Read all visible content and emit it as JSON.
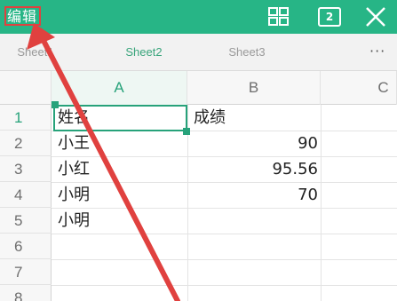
{
  "toolbar": {
    "edit_label": "编辑",
    "grid_icon": "grid-view-icon",
    "page_count": "2",
    "close_icon": "close-icon"
  },
  "tabs": [
    {
      "label": "Sheet1",
      "active": false
    },
    {
      "label": "Sheet2",
      "active": true
    },
    {
      "label": "Sheet3",
      "active": false
    }
  ],
  "more_label": "···",
  "columns": [
    "A",
    "B",
    "C"
  ],
  "rows": [
    "1",
    "2",
    "3",
    "4",
    "5",
    "6",
    "7",
    "8"
  ],
  "cells": {
    "a1": "姓名",
    "b1": "成绩",
    "a2": "小王",
    "b2": "90",
    "a3": "小红",
    "b3": "95.56",
    "a4": "小明",
    "b4": "70",
    "a5": "小明"
  },
  "colors": {
    "brand": "#27b586",
    "selection": "#27a27a",
    "annotation": "#e0413f"
  }
}
